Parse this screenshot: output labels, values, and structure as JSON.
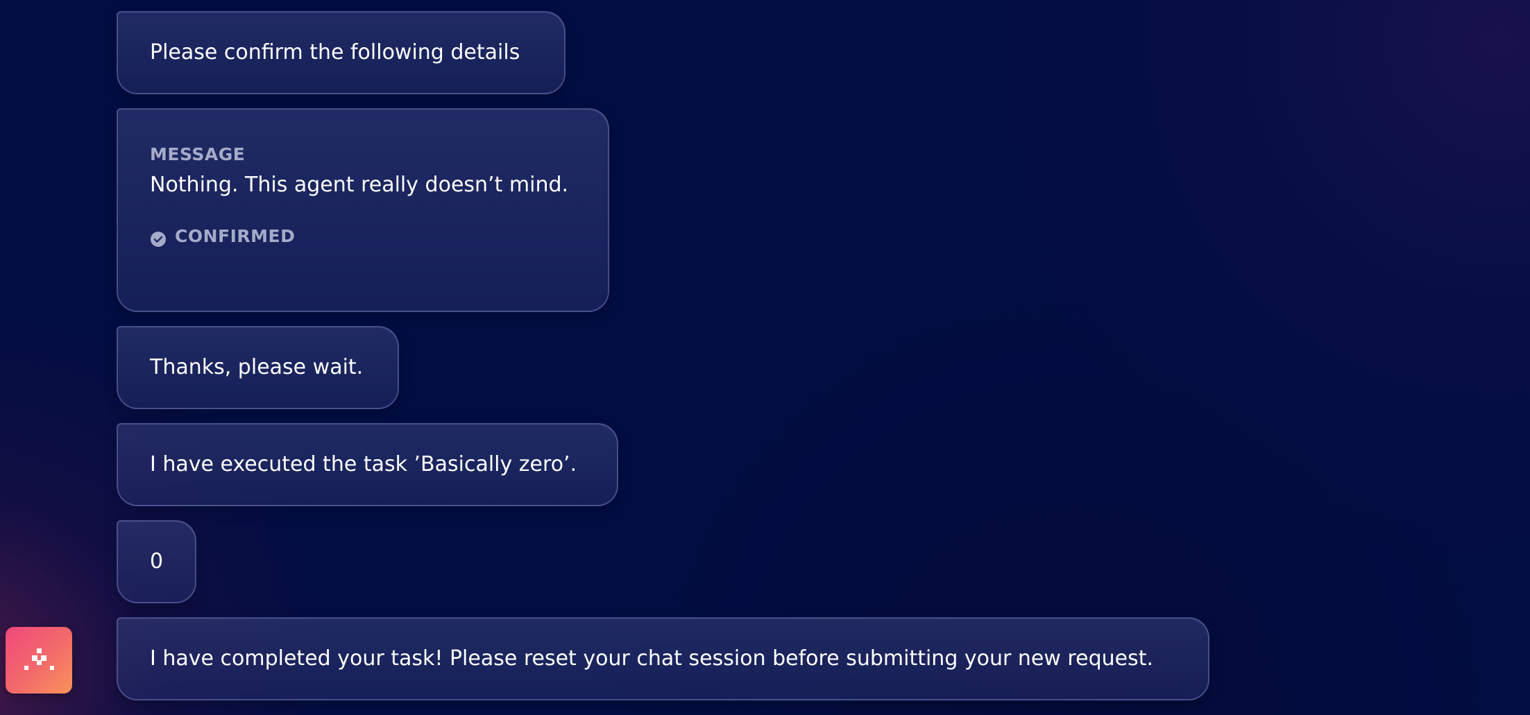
{
  "chat": {
    "messages": [
      {
        "text": "Please confirm the following details"
      },
      {
        "label": "MESSAGE",
        "value": "Nothing. This agent really doesn’t mind.",
        "status": "CONFIRMED",
        "status_icon": "check-circle-icon"
      },
      {
        "text": "Thanks, please wait."
      },
      {
        "text": "I have executed the task ’Basically zero’."
      },
      {
        "text": "0"
      },
      {
        "text": "I have completed your task! Please reset your chat session before submitting your new request."
      }
    ]
  },
  "agent": {
    "avatar_icon": "agent-dots-icon",
    "avatar_colors": [
      "#f0487c",
      "#f7945a"
    ]
  },
  "theme": {
    "background": "#020d42",
    "bubble_border": "#6872b0",
    "muted_text": "#a6abc9"
  }
}
